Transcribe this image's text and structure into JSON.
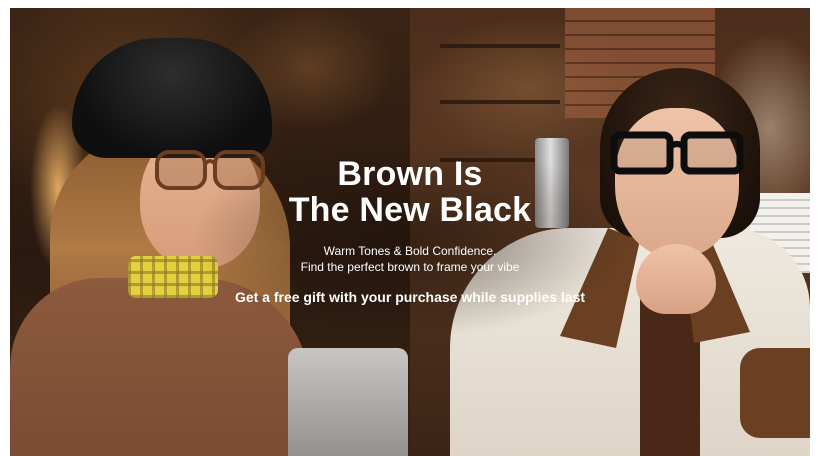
{
  "hero": {
    "headline_line1": "Brown Is",
    "headline_line2": "The New Black",
    "subtitle_line1": "Warm Tones & Bold Confidence.",
    "subtitle_line2": "Find the perfect brown to frame your vibe",
    "promo": "Get a free gift with your purchase while supplies last"
  },
  "colors": {
    "text": "#ffffff",
    "background_dark": "#3a2416",
    "coat_cream": "#efe9df",
    "collar_brown": "#6a3f22",
    "sweater_brown": "#8d5a3d",
    "scarf_yellow": "#e4cf3e"
  }
}
